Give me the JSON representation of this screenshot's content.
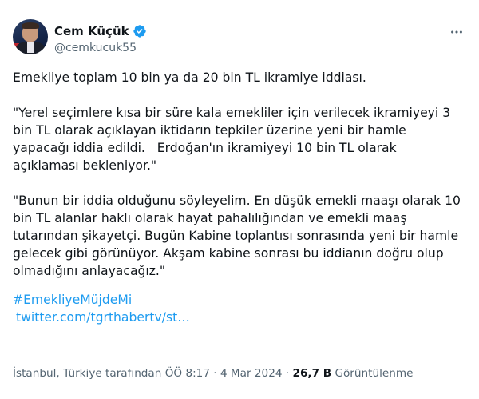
{
  "author": {
    "display_name": "Cem Küçük",
    "handle": "@cemkucuk55",
    "verified_color": "#1d9bf0"
  },
  "tweet": {
    "paragraphs": [
      "Emekliye toplam 10 bin ya da 20 bin TL ikramiye iddiası.",
      "\"Yerel seçimlere kısa bir süre kala emekliler için verilecek ikramiyeyi 3 bin TL olarak açıklayan iktidarın tepkiler üzerine yeni bir hamle yapacağı iddia edildi.   Erdoğan'ın ikramiyeyi 10 bin TL olarak açıklaması bekleniyor.\"",
      "\"Bunun bir iddia olduğunu söyleyelim. En düşük emekli maaşı olarak 10 bin TL alanlar haklı olarak hayat pahalılığından ve emekli maaş tutarından şikayetçi. Bugün Kabine toplantısı sonrasında yeni bir hamle gelecek gibi görünüyor. Akşam kabine sonrası bu iddianın doğru olup olmadığını anlayacağız.\""
    ],
    "hashtag": "#EmekliyeMüjdeMi",
    "link": "twitter.com/tgrthabertv/st…"
  },
  "meta": {
    "location": "İstanbul, Türkiye tarafından",
    "time": "ÖÖ 8:17",
    "separator": "·",
    "date": "4 Mar 2024",
    "views_count": "26,7 B",
    "views_label": "Görüntülenme"
  },
  "icons": {
    "verified": "verified-badge-icon",
    "more": "more-horizontal-icon"
  }
}
